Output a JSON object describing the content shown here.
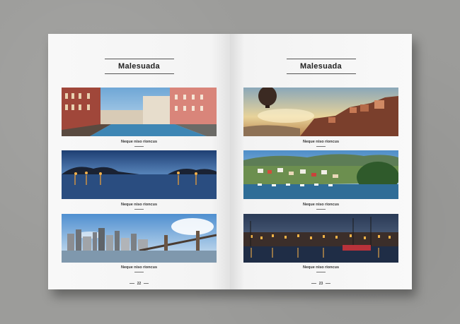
{
  "spread": {
    "left_page": {
      "heading": "Malesuada",
      "page_number": "22",
      "photos": [
        {
          "caption": "Neque niso rioncus",
          "scene": "canal-city"
        },
        {
          "caption": "Neque niso rioncus",
          "scene": "lake-dusk"
        },
        {
          "caption": "Neque niso rioncus",
          "scene": "skyline-bridge"
        }
      ]
    },
    "right_page": {
      "heading": "Malesuada",
      "page_number": "23",
      "photos": [
        {
          "caption": "Neque niso rioncus",
          "scene": "hot-air-balloon-town"
        },
        {
          "caption": "Neque niso rioncus",
          "scene": "harbor-village"
        },
        {
          "caption": "Neque niso rioncus",
          "scene": "night-harbor"
        }
      ]
    }
  },
  "colors": {
    "background": "#9c9c9a",
    "paper": "#f7f7f7",
    "text": "#222222"
  }
}
